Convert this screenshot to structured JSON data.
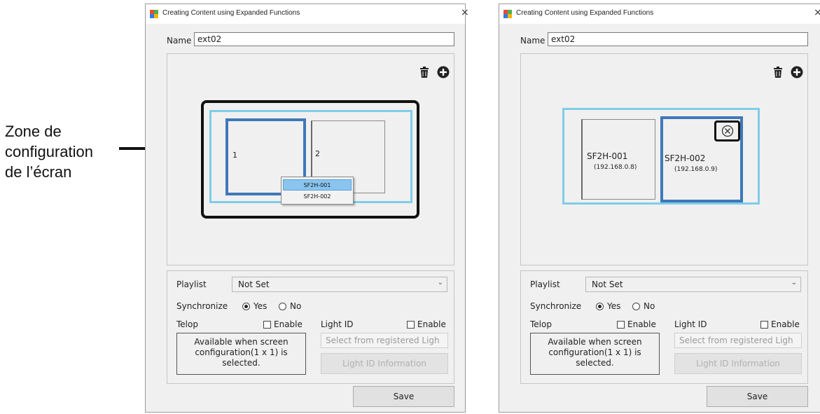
{
  "annotation": {
    "lines": [
      "Zone de",
      "configuration",
      "de l’écran"
    ]
  },
  "window_title": "Creating Content using Expanded Functions",
  "close_glyph": "×",
  "name_label": "Name",
  "name_value": "ext02",
  "displays_left": [
    {
      "num": "1"
    },
    {
      "num": "2"
    }
  ],
  "device_menu": [
    "SF2H-001",
    "SF2H-002"
  ],
  "displays_right": [
    {
      "name": "SF2H-001",
      "ip": "(192.168.0.8)"
    },
    {
      "name": "SF2H-002",
      "ip": "(192.168.0.9)"
    }
  ],
  "playlist": {
    "label": "Playlist",
    "value": "Not Set"
  },
  "synchronize": {
    "label": "Synchronize",
    "yes": "Yes",
    "no": "No",
    "selected": "Yes"
  },
  "telop": {
    "label": "Telop",
    "enable": "Enable",
    "info": [
      "Available when screen",
      "configuration(1 x 1) is",
      "selected."
    ]
  },
  "light_id": {
    "label": "Light ID",
    "enable": "Enable",
    "placeholder": "Select from registered Ligh",
    "info_button": "Light ID Information"
  },
  "save_label": "Save",
  "icons": {
    "trash": "trash-icon",
    "add": "add-circle-icon",
    "remove": "remove-circle-icon",
    "app": "app-icon"
  },
  "colors": {
    "selected_border": "#3f78b8",
    "screen_area": "#7fcde9",
    "menu_highlight": "#8ac5ef"
  }
}
